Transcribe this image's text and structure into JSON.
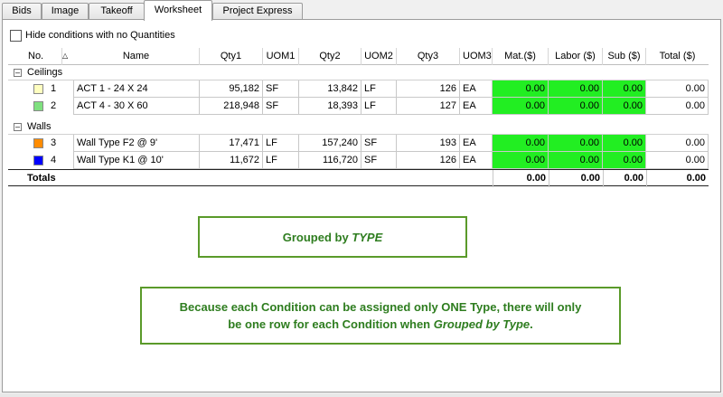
{
  "tabs": [
    "Bids",
    "Image",
    "Takeoff",
    "Worksheet",
    "Project Express"
  ],
  "active_tab": "Worksheet",
  "hide_conditions_label": "Hide conditions with no Quantities",
  "columns": {
    "no": "No.",
    "name": "Name",
    "qty1": "Qty1",
    "uom1": "UOM1",
    "qty2": "Qty2",
    "uom2": "UOM2",
    "qty3": "Qty3",
    "uom3": "UOM3",
    "mat": "Mat.($)",
    "labor": "Labor ($)",
    "sub": "Sub ($)",
    "total": "Total ($)"
  },
  "groups": [
    {
      "name": "Ceilings",
      "rows": [
        {
          "swatch": "#ffffc0",
          "no": "1",
          "name": "ACT 1 - 24 X 24",
          "qty1": "95,182",
          "uom1": "SF",
          "qty2": "13,842",
          "uom2": "LF",
          "qty3": "126",
          "uom3": "EA",
          "mat": "0.00",
          "labor": "0.00",
          "sub": "0.00",
          "total": "0.00"
        },
        {
          "swatch": "#7fe07f",
          "no": "2",
          "name": "ACT 4 - 30 X 60",
          "qty1": "218,948",
          "uom1": "SF",
          "qty2": "18,393",
          "uom2": "LF",
          "qty3": "127",
          "uom3": "EA",
          "mat": "0.00",
          "labor": "0.00",
          "sub": "0.00",
          "total": "0.00"
        }
      ]
    },
    {
      "name": "Walls",
      "rows": [
        {
          "swatch": "#ff8c00",
          "no": "3",
          "name": "Wall Type F2 @ 9'",
          "qty1": "17,471",
          "uom1": "LF",
          "qty2": "157,240",
          "uom2": "SF",
          "qty3": "193",
          "uom3": "EA",
          "mat": "0.00",
          "labor": "0.00",
          "sub": "0.00",
          "total": "0.00"
        },
        {
          "swatch": "#0000ff",
          "no": "4",
          "name": "Wall Type K1 @ 10'",
          "qty1": "11,672",
          "uom1": "LF",
          "qty2": "116,720",
          "uom2": "SF",
          "qty3": "126",
          "uom3": "EA",
          "mat": "0.00",
          "labor": "0.00",
          "sub": "0.00",
          "total": "0.00"
        }
      ]
    }
  ],
  "totals": {
    "label": "Totals",
    "mat": "0.00",
    "labor": "0.00",
    "sub": "0.00",
    "total": "0.00"
  },
  "callout1": {
    "prefix": "Grouped by ",
    "emph": "TYPE"
  },
  "callout2": {
    "line1": "Because each Condition can be assigned only ONE Type, there will only",
    "line2_prefix": "be one row for each Condition when ",
    "line2_emph": "Grouped by Type",
    "line2_suffix": "."
  },
  "colors": {
    "cost_highlight": "#22ee22",
    "callout_border": "#5a9a2a",
    "callout_text": "#2e7d1f"
  }
}
